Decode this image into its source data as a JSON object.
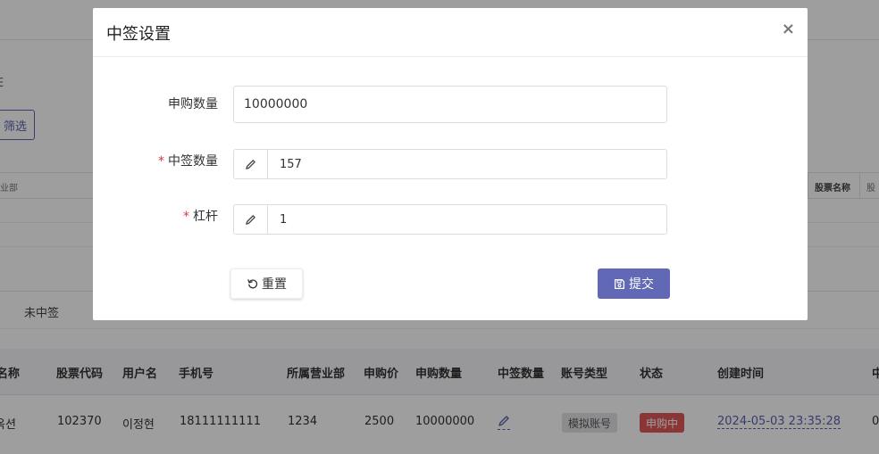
{
  "background": {
    "edge_text": "E",
    "filter_button_label": "筛选",
    "mini_table_headers": {
      "left": "业部",
      "stock_name": "股票名称",
      "stock_code": "股"
    },
    "tabs": {
      "not_won": "未中签"
    },
    "table_headers": {
      "stock_name": "名称",
      "stock_code": "股票代码",
      "username": "用户名",
      "phone": "手机号",
      "department": "所属营业部",
      "price": "申购价",
      "subscribe_qty": "申购数量",
      "won_qty": "中签数量",
      "account_type": "账号类型",
      "status": "状态",
      "created_time": "创建时间",
      "overflow": "中"
    },
    "row": {
      "stock_name": "옥션",
      "stock_code": "102370",
      "username": "이정현",
      "phone": "18111111111",
      "department": "1234",
      "price": "2500",
      "subscribe_qty": "10000000",
      "account_type": "模拟账号",
      "status": "申购中",
      "created_time": "2024-05-03 23:35:28",
      "overflow": "0"
    }
  },
  "modal": {
    "title": "中签设置",
    "close_symbol": "×",
    "fields": {
      "subscribe_qty_label": "申购数量",
      "subscribe_qty_value": "10000000",
      "won_qty_required": "*",
      "won_qty_label": "中签数量",
      "won_qty_value": "157",
      "leverage_required": "*",
      "leverage_label": "杠杆",
      "leverage_value": "1"
    },
    "reset_label": "重置",
    "submit_label": "提交"
  },
  "colors": {
    "accent": "#6168b5",
    "required": "#d9363e",
    "status_red": "#e05757",
    "tag_grey": "#e3e3e6"
  },
  "icons": {
    "edit": "pencil-icon",
    "reset": "rotate-ccw-icon",
    "submit": "save-icon"
  }
}
